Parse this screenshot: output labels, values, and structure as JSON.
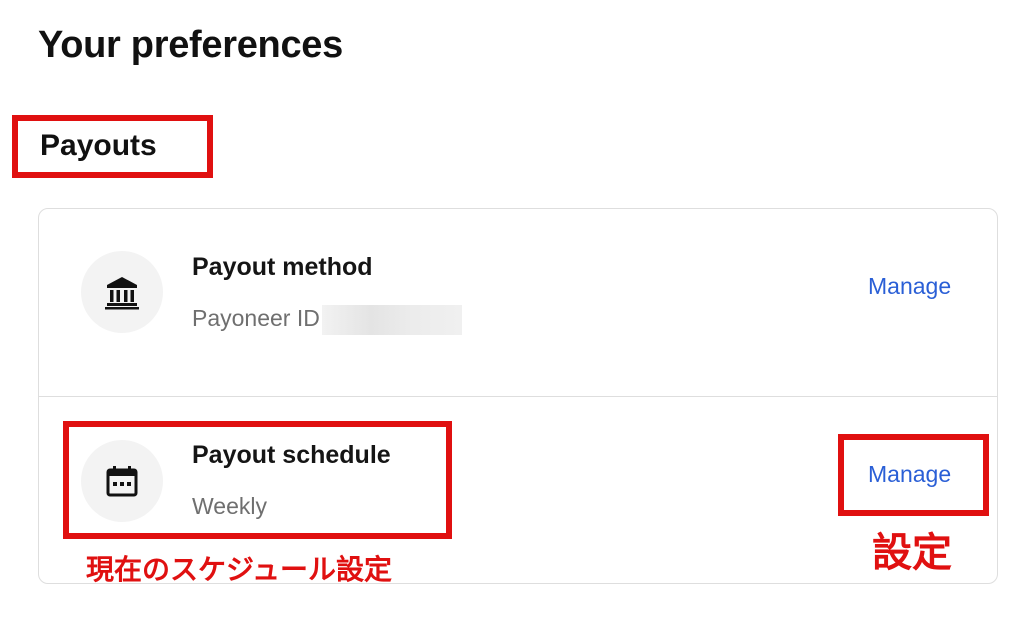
{
  "page": {
    "title": "Your preferences"
  },
  "payouts": {
    "heading": "Payouts",
    "rows": [
      {
        "icon": "bank-icon",
        "title": "Payout method",
        "subtitle": "Payoneer ID",
        "action": "Manage"
      },
      {
        "icon": "calendar-icon",
        "title": "Payout schedule",
        "subtitle": "Weekly",
        "action": "Manage"
      }
    ]
  },
  "annotations": {
    "schedule_note": "現在のスケジュール設定",
    "manage_note": "設定",
    "color": "#e01010"
  },
  "colors": {
    "link": "#2a5fd6",
    "icon_bg": "#f3f3f3",
    "border": "#dedede"
  }
}
